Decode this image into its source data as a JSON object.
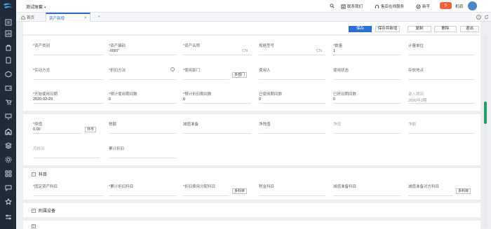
{
  "app": {
    "title": "测试账套"
  },
  "topbar": {
    "contact": "联系我们",
    "service": "售后在线服务",
    "newbie": "新手",
    "newbie_badge": "5",
    "machine": "机调"
  },
  "tabs": {
    "home": "首页",
    "active": "资产新增"
  },
  "toolbar": {
    "save": "保存",
    "save_new": "保存并新增",
    "copy": "复制",
    "delete": "删除",
    "exit": "退出"
  },
  "form1": {
    "asset_category": {
      "label": "*资产类别",
      "value": ""
    },
    "asset_code": {
      "label": "*资产编码",
      "value": "-0007"
    },
    "asset_name": {
      "label": "*资产名称",
      "value": "",
      "suffix": "CN"
    },
    "spec_model": {
      "label": "规格型号",
      "value": "",
      "suffix": "CN"
    },
    "quantity": {
      "label": "*数量",
      "value": "1"
    },
    "unit": {
      "label": "计量单位",
      "value": ""
    },
    "acquire_method": {
      "label": "*实动方式",
      "value": ""
    },
    "depreciation_method": {
      "label": "*折旧方法",
      "value": ""
    },
    "use_dept": {
      "label": "*使用部门",
      "value": "",
      "button": "多部门"
    },
    "user": {
      "label": "使用人",
      "value": ""
    },
    "use_status": {
      "label": "使用状态",
      "value": ""
    },
    "location": {
      "label": "存放地点",
      "value": ""
    },
    "start_date": {
      "label": "*开始使用日期",
      "value": "2020-02-29"
    },
    "expected_periods": {
      "label": "*预计使用期间数",
      "value": "0"
    },
    "expected_dep_periods": {
      "label": "*预计折旧期间数",
      "value": "0"
    },
    "used_periods": {
      "label": "已使用期间数",
      "value": "0"
    },
    "dep_periods_done": {
      "label": "已折旧期间数",
      "value": "0"
    },
    "entry_period": {
      "label": "录入期间",
      "value": "2020年2期"
    }
  },
  "form2": {
    "original_value": {
      "label": "*原值",
      "value": "0.00",
      "button": "外币"
    },
    "tax_amount": {
      "label": "税额",
      "value": ""
    },
    "impairment": {
      "label": "减值准备",
      "value": ""
    },
    "residual": {
      "label": "净残值",
      "value": ""
    },
    "net_value": {
      "label": "净值",
      "value": ""
    },
    "net_amount": {
      "label": "净额",
      "value": ""
    },
    "monthly_dep": {
      "label": "月折旧",
      "value": ""
    },
    "accum_dep": {
      "label": "累计折旧",
      "value": ""
    }
  },
  "accounts": {
    "title": "科目",
    "fixed_asset_account": {
      "label": "*固定资产科目",
      "value": ""
    },
    "accum_dep_account": {
      "label": "*累计折旧科目",
      "value": ""
    },
    "dep_expense_account": {
      "label": "*折旧费用分配科目",
      "value": "",
      "button": "多科目"
    },
    "tax_account": {
      "label": "税金科目",
      "value": ""
    },
    "impairment_account": {
      "label": "减值准备科目",
      "value": ""
    },
    "impairment_contra_account": {
      "label": "减值准备对方科目",
      "value": "",
      "button": "多科目"
    }
  },
  "equipment": {
    "title": "附属设备"
  }
}
